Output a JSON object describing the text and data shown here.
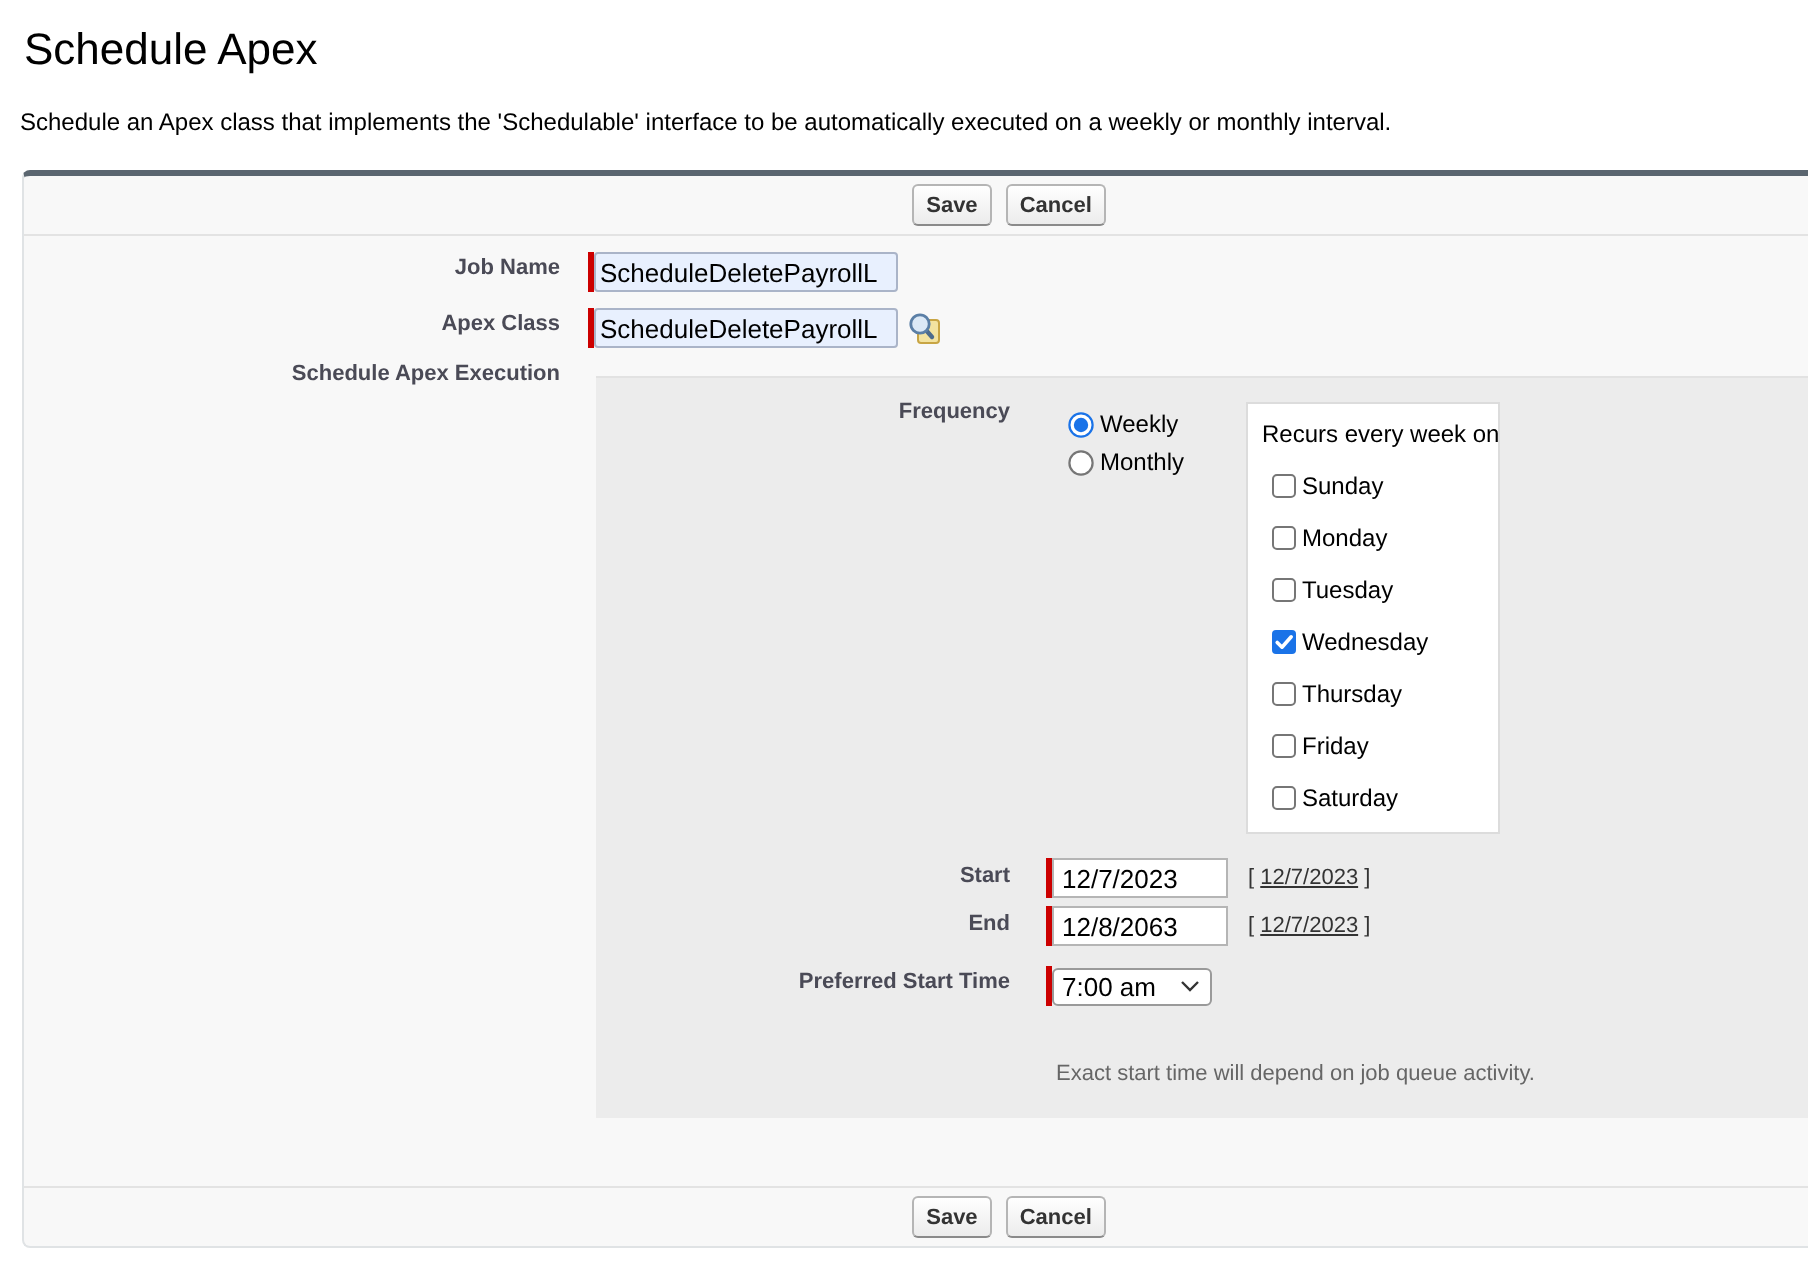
{
  "title": "Schedule Apex",
  "description": "Schedule an Apex class that implements the 'Schedulable' interface to be automatically executed on a weekly or monthly interval.",
  "top_buttons": [
    "Save",
    "Cancel"
  ],
  "fields": [
    {
      "label": "Job Name",
      "value": "ScheduleDeletePayrollL",
      "required": true,
      "lookup": false
    },
    {
      "label": "Apex Class",
      "value": "ScheduleDeletePayrollL",
      "required": true,
      "lookup": true
    }
  ],
  "execution": {
    "label": "Schedule Apex Execution",
    "frequency": {
      "label": "Frequency",
      "options": [
        {
          "label": "Weekly",
          "selected": true
        },
        {
          "label": "Monthly",
          "selected": false
        }
      ]
    },
    "recurs": {
      "heading": "Recurs every week on",
      "days": [
        {
          "label": "Sunday",
          "checked": false
        },
        {
          "label": "Monday",
          "checked": false
        },
        {
          "label": "Tuesday",
          "checked": false
        },
        {
          "label": "Wednesday",
          "checked": true
        },
        {
          "label": "Thursday",
          "checked": false
        },
        {
          "label": "Friday",
          "checked": false
        },
        {
          "label": "Saturday",
          "checked": false
        }
      ]
    },
    "dates": [
      {
        "label": "Start",
        "value": "12/7/2023",
        "required": true,
        "shortcut_open": "[",
        "shortcut_link": "12/7/2023",
        "shortcut_close": "]"
      },
      {
        "label": "End",
        "value": "12/8/2063",
        "required": true,
        "shortcut_open": "[",
        "shortcut_link": "12/7/2023",
        "shortcut_close": "]"
      }
    ],
    "start_time": {
      "label": "Preferred Start Time",
      "value": "7:00 am",
      "required": true
    },
    "note": "Exact start time will depend on job queue activity."
  },
  "bottom_buttons": [
    "Save",
    "Cancel"
  ]
}
